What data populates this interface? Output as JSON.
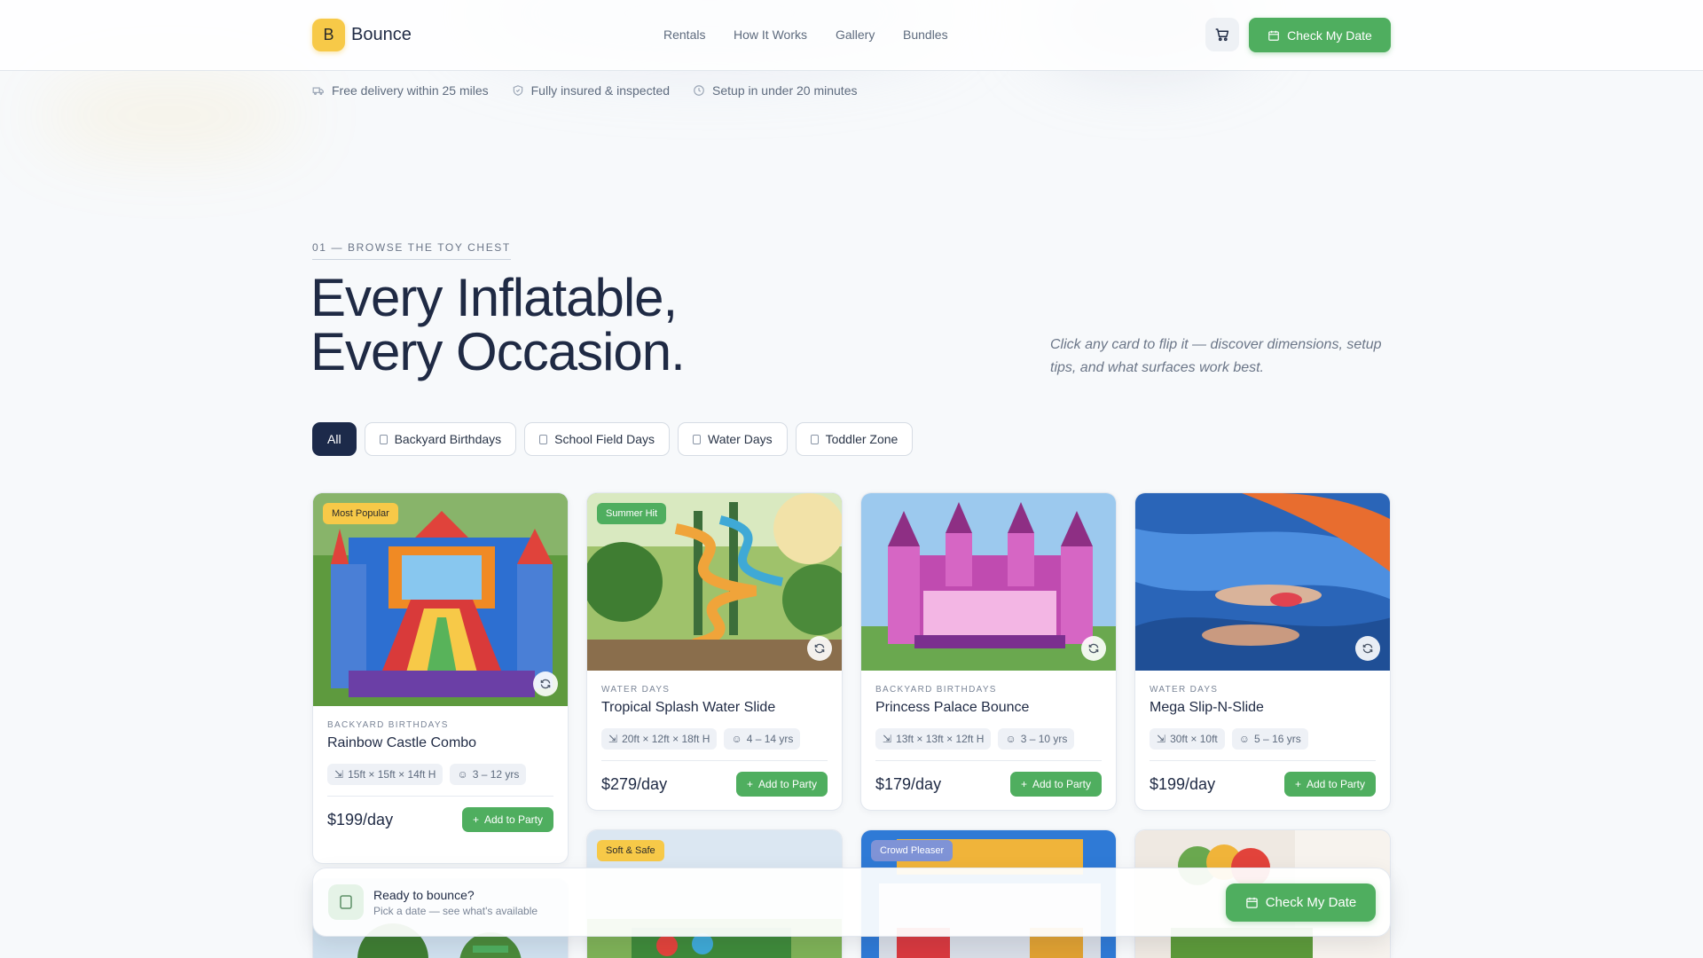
{
  "brand": {
    "initial": "B",
    "name": "Bounce"
  },
  "nav": {
    "items": [
      "Rentals",
      "How It Works",
      "Gallery",
      "Bundles"
    ]
  },
  "header": {
    "cta_label": "Check My Date"
  },
  "perks": [
    "Free delivery within 25 miles",
    "Fully insured & inspected",
    "Setup in under 20 minutes"
  ],
  "section": {
    "eyebrow": "01 — BROWSE THE TOY CHEST",
    "headline_line1": "Every Inflatable,",
    "headline_line2": "Every Occasion.",
    "hint": "Click any card to flip it — discover dimensions, setup tips, and what surfaces work best."
  },
  "filters": [
    "All",
    "Backyard Birthdays",
    "School Field Days",
    "Water Days",
    "Toddler Zone"
  ],
  "add_label": "Add to Party",
  "products": [
    {
      "badge": "Most Popular",
      "badge_color": "#f7c948",
      "category": "BACKYARD BIRTHDAYS",
      "title": "Rainbow Castle Combo",
      "size": "15ft × 15ft × 14ft H",
      "ages": "3 – 12 yrs",
      "price": "$199/day"
    },
    {
      "badge": "Summer Hit",
      "badge_color": "#4fae5f",
      "category": "WATER DAYS",
      "title": "Tropical Splash Water Slide",
      "size": "20ft × 12ft × 18ft H",
      "ages": "4 – 14 yrs",
      "price": "$279/day"
    },
    {
      "badge": "",
      "badge_color": "",
      "category": "BACKYARD BIRTHDAYS",
      "title": "Princess Palace Bounce",
      "size": "13ft × 13ft × 12ft H",
      "ages": "3 – 10 yrs",
      "price": "$179/day"
    },
    {
      "badge": "",
      "badge_color": "",
      "category": "WATER DAYS",
      "title": "Mega Slip-N-Slide",
      "size": "30ft × 10ft",
      "ages": "5 – 16 yrs",
      "price": "$199/day"
    }
  ],
  "more_badges": [
    {
      "text": "Soft & Safe",
      "color": "#f7c948"
    },
    {
      "text": "Crowd Pleaser",
      "color": "#7f93d6"
    }
  ],
  "sticky": {
    "title": "Ready to bounce?",
    "subtitle": "Pick a date — see what's available",
    "cta_label": "Check My Date"
  }
}
